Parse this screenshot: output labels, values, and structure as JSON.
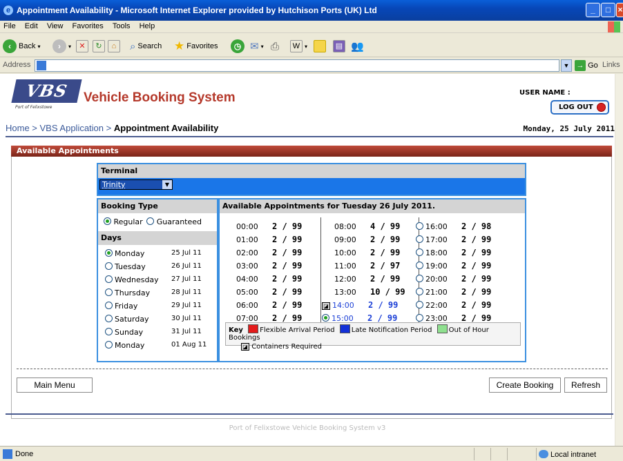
{
  "window": {
    "title": "Appointment Availability - Microsoft Internet Explorer provided by Hutchison Ports (UK) Ltd"
  },
  "menu": [
    "File",
    "Edit",
    "View",
    "Favorites",
    "Tools",
    "Help"
  ],
  "toolbar": {
    "back": "Back",
    "search": "Search",
    "favorites": "Favorites"
  },
  "address": {
    "label": "Address",
    "go": "Go",
    "links": "Links"
  },
  "header": {
    "logo": "VBS",
    "logo_sub": "Port of Felixstowe",
    "app_title": "Vehicle Booking System",
    "user_label": "USER NAME :",
    "logout": "LOG OUT",
    "date": "Monday, 25 July 2011"
  },
  "breadcrumb": {
    "home": "Home",
    "sep": " > ",
    "app": "VBS Application",
    "current": "Appointment Availability"
  },
  "panel": {
    "title": "Available Appointments"
  },
  "terminal": {
    "heading": "Terminal",
    "selected": "Trinity"
  },
  "booking_type": {
    "heading": "Booking Type",
    "regular": "Regular",
    "guaranteed": "Guaranteed"
  },
  "days": {
    "heading": "Days",
    "items": [
      {
        "name": "Monday",
        "date": "25 Jul 11",
        "selected": true
      },
      {
        "name": "Tuesday",
        "date": "26 Jul 11",
        "selected": false
      },
      {
        "name": "Wednesday",
        "date": "27 Jul 11",
        "selected": false
      },
      {
        "name": "Thursday",
        "date": "28 Jul 11",
        "selected": false
      },
      {
        "name": "Friday",
        "date": "29 Jul 11",
        "selected": false
      },
      {
        "name": "Saturday",
        "date": "30 Jul 11",
        "selected": false
      },
      {
        "name": "Sunday",
        "date": "31 Jul 11",
        "selected": false
      },
      {
        "name": "Monday",
        "date": "01 Aug 11",
        "selected": false
      }
    ]
  },
  "availability": {
    "heading": "Available Appointments for Tuesday 26 July 2011.",
    "columns": [
      [
        {
          "time": "00:00",
          "count": "2 / 99"
        },
        {
          "time": "01:00",
          "count": "2 / 99"
        },
        {
          "time": "02:00",
          "count": "2 / 99"
        },
        {
          "time": "03:00",
          "count": "2 / 99"
        },
        {
          "time": "04:00",
          "count": "2 / 99"
        },
        {
          "time": "05:00",
          "count": "2 / 99"
        },
        {
          "time": "06:00",
          "count": "2 / 99"
        },
        {
          "time": "07:00",
          "count": "2 / 99"
        }
      ],
      [
        {
          "time": "08:00",
          "count": "4 / 99"
        },
        {
          "time": "09:00",
          "count": "2 / 99"
        },
        {
          "time": "10:00",
          "count": "2 / 99"
        },
        {
          "time": "11:00",
          "count": "2 / 97"
        },
        {
          "time": "12:00",
          "count": "2 / 99"
        },
        {
          "time": "13:00",
          "count": "10 / 99"
        },
        {
          "time": "14:00",
          "count": "2 / 99",
          "late": true,
          "container": true
        },
        {
          "time": "15:00",
          "count": "2 / 99",
          "late": true,
          "radio": true,
          "selected": true
        }
      ],
      [
        {
          "time": "16:00",
          "count": "2 / 98",
          "radio": true
        },
        {
          "time": "17:00",
          "count": "2 / 99",
          "radio": true
        },
        {
          "time": "18:00",
          "count": "2 / 99",
          "radio": true
        },
        {
          "time": "19:00",
          "count": "2 / 99",
          "radio": true
        },
        {
          "time": "20:00",
          "count": "2 / 99",
          "radio": true
        },
        {
          "time": "21:00",
          "count": "2 / 99",
          "radio": true
        },
        {
          "time": "22:00",
          "count": "2 / 99",
          "radio": true
        },
        {
          "time": "23:00",
          "count": "2 / 99",
          "radio": true
        }
      ]
    ]
  },
  "key": {
    "label": "Key",
    "items": [
      {
        "label": "Flexible Arrival Period",
        "color": "#e41b1b"
      },
      {
        "label": "Late Notification Period",
        "color": "#1230d8"
      },
      {
        "label": "Out of Hour Bookings",
        "color": "#8fe08f"
      }
    ],
    "containers": "Containers Required"
  },
  "buttons": {
    "main_menu": "Main Menu",
    "create_booking": "Create Booking",
    "refresh": "Refresh"
  },
  "footer": "Port of Felixstowe Vehicle Booking System v3",
  "status": {
    "left": "Done",
    "zone": "Local intranet"
  }
}
